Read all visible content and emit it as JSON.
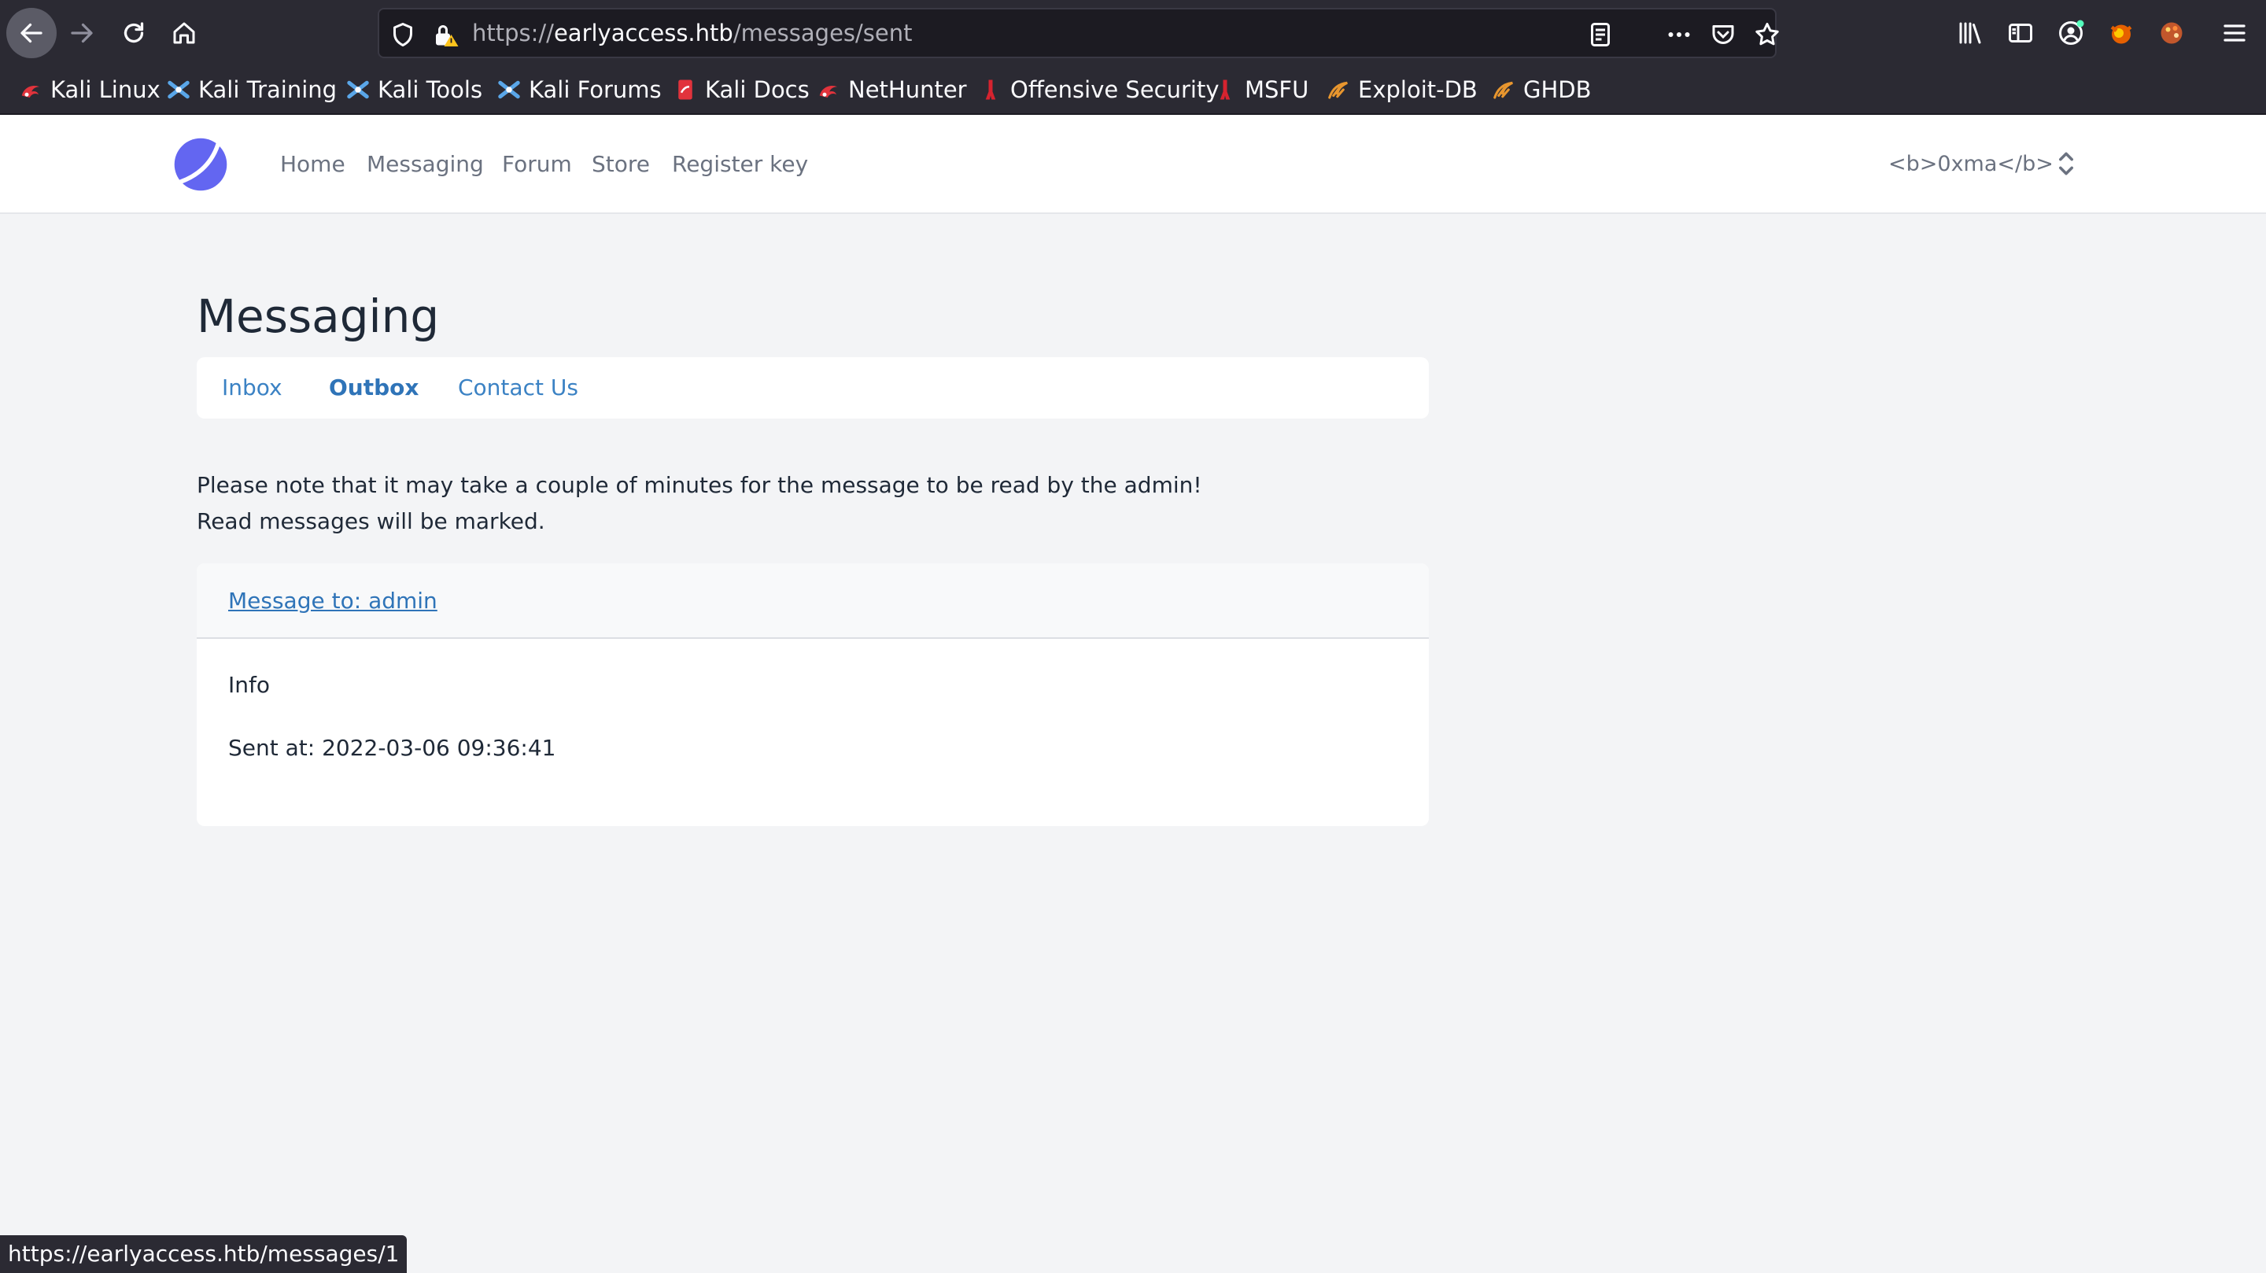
{
  "browser": {
    "url_scheme": "https://",
    "url_host": "earlyaccess.htb",
    "url_path": "/messages/sent",
    "icons": [
      "back-icon",
      "forward-icon",
      "reload-icon",
      "home-icon",
      "shield-icon",
      "insecure-lock-icon",
      "reader-view-icon",
      "more-icon",
      "pocket-icon",
      "star-icon",
      "library-icon",
      "sidebar-icon",
      "account-icon",
      "extension-icon",
      "palette-icon",
      "menu-icon"
    ],
    "bookmarks": [
      {
        "label": "Kali Linux",
        "icon": "kali-dragon-icon"
      },
      {
        "label": "Kali Training",
        "icon": "kali-training-icon"
      },
      {
        "label": "Kali Tools",
        "icon": "kali-tools-icon"
      },
      {
        "label": "Kali Forums",
        "icon": "kali-forums-icon"
      },
      {
        "label": "Kali Docs",
        "icon": "kali-docs-icon"
      },
      {
        "label": "NetHunter",
        "icon": "nethunter-icon"
      },
      {
        "label": "Offensive Security",
        "icon": "offsec-icon"
      },
      {
        "label": "MSFU",
        "icon": "msfu-icon"
      },
      {
        "label": "Exploit-DB",
        "icon": "exploit-db-icon"
      },
      {
        "label": "GHDB",
        "icon": "ghdb-icon"
      }
    ],
    "status_url": "https://earlyaccess.htb/messages/1"
  },
  "header": {
    "nav": [
      "Home",
      "Messaging",
      "Forum",
      "Store",
      "Register key"
    ],
    "user_label": "<b>0xma</b>"
  },
  "main": {
    "title": "Messaging",
    "tabs": [
      "Inbox",
      "Outbox",
      "Contact Us"
    ],
    "active_tab": "Outbox",
    "notice_line1": "Please note that it may take a couple of minutes for the message to be read by the admin!",
    "notice_line2": "Read messages will be marked.",
    "message": {
      "link": "Message to: admin",
      "subject": "Info",
      "sent_at": "Sent at: 2022-03-06 09:36:41"
    }
  },
  "colors": {
    "chrome_bg": "#2b2a33",
    "url_bg": "#1c1b22",
    "page_bg": "#f3f4f6",
    "link": "#2f74b8",
    "logo": "#6366f1"
  }
}
